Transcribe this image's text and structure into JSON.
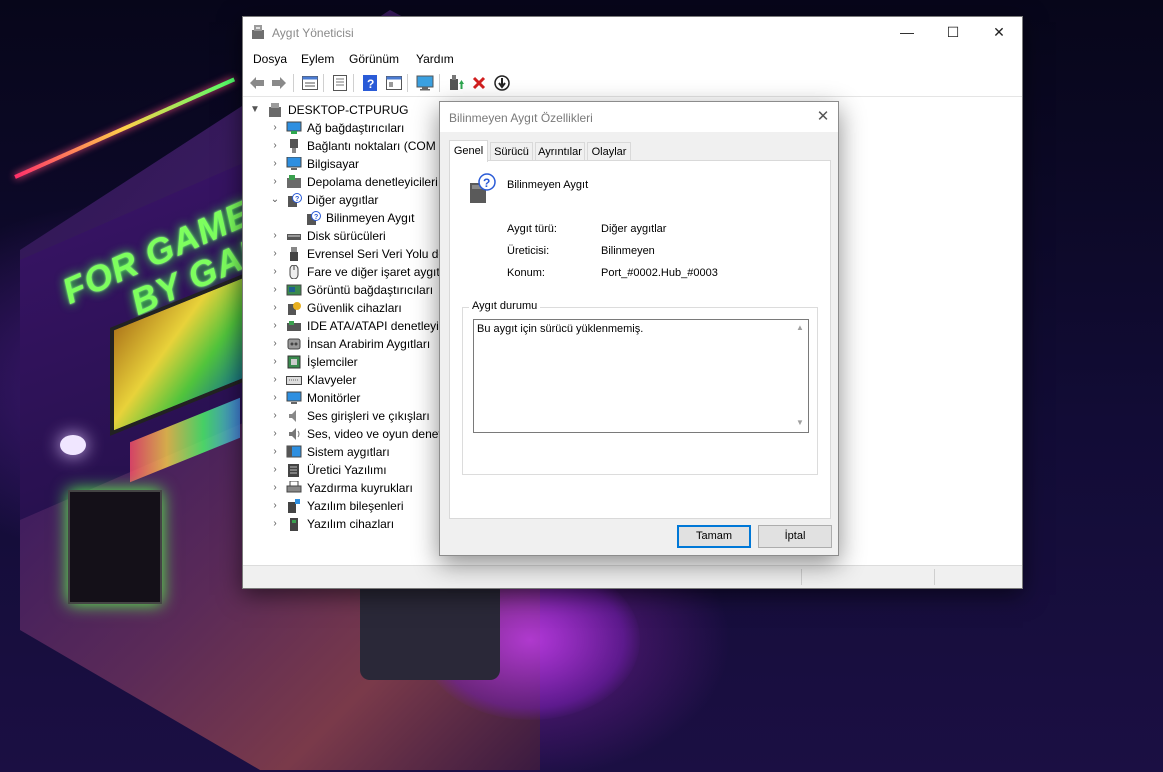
{
  "window": {
    "title": "Aygıt Yöneticisi",
    "controls": {
      "minimize": "—",
      "maximize": "☐",
      "close": "✕"
    }
  },
  "menu": [
    "Dosya",
    "Eylem",
    "Görünüm",
    "Yardım"
  ],
  "toolbar": {
    "icons": [
      "back-arrow-icon",
      "forward-arrow-icon",
      "properties-grid-icon",
      "list-view-icon",
      "help-icon",
      "details-view-icon",
      "scan-monitor-icon",
      "add-driver-icon",
      "uninstall-x-icon",
      "update-driver-icon"
    ],
    "colors": {
      "uninstall": "#d11f1f",
      "help": "#2a5bd7"
    }
  },
  "tree": {
    "root": "DESKTOP-CTPURUG",
    "items": [
      {
        "label": "Ağ bağdaştırıcıları",
        "icon": "network-adapter-icon"
      },
      {
        "label": "Bağlantı noktaları (COM ve LPT)",
        "icon": "port-icon"
      },
      {
        "label": "Bilgisayar",
        "icon": "computer-icon"
      },
      {
        "label": "Depolama denetleyicileri",
        "icon": "storage-controller-icon"
      },
      {
        "label": "Diğer aygıtlar",
        "icon": "other-devices-icon",
        "expanded": true
      },
      {
        "label": "Bilinmeyen Aygıt",
        "icon": "unknown-device-icon",
        "child": true
      },
      {
        "label": "Disk sürücüleri",
        "icon": "disk-drive-icon"
      },
      {
        "label": "Evrensel Seri Veri Yolu denetleyicileri",
        "icon": "usb-icon"
      },
      {
        "label": "Fare ve diğer işaret aygıtları",
        "icon": "mouse-icon"
      },
      {
        "label": "Görüntü bağdaştırıcıları",
        "icon": "display-adapter-icon"
      },
      {
        "label": "Güvenlik cihazları",
        "icon": "security-device-icon"
      },
      {
        "label": "IDE ATA/ATAPI denetleyicileri",
        "icon": "ide-controller-icon"
      },
      {
        "label": "İnsan Arabirim Aygıtları",
        "icon": "hid-icon"
      },
      {
        "label": "İşlemciler",
        "icon": "processor-icon"
      },
      {
        "label": "Klavyeler",
        "icon": "keyboard-icon"
      },
      {
        "label": "Monitörler",
        "icon": "monitor-icon"
      },
      {
        "label": "Ses girişleri ve çıkışları",
        "icon": "audio-io-icon"
      },
      {
        "label": "Ses, video ve oyun denetleyicileri",
        "icon": "sound-video-icon"
      },
      {
        "label": "Sistem aygıtları",
        "icon": "system-devices-icon"
      },
      {
        "label": "Üretici Yazılımı",
        "icon": "firmware-icon"
      },
      {
        "label": "Yazdırma kuyrukları",
        "icon": "print-queue-icon"
      },
      {
        "label": "Yazılım bileşenleri",
        "icon": "software-component-icon"
      },
      {
        "label": "Yazılım cihazları",
        "icon": "software-device-icon"
      }
    ]
  },
  "dialog": {
    "title": "Bilinmeyen Aygıt Özellikleri",
    "tabs": [
      "Genel",
      "Sürücü",
      "Ayrıntılar",
      "Olaylar"
    ],
    "active_tab": "Genel",
    "device_name": "Bilinmeyen Aygıt",
    "props": [
      {
        "key": "Aygıt türü:",
        "value": "Diğer aygıtlar"
      },
      {
        "key": "Üreticisi:",
        "value": "Bilinmeyen"
      },
      {
        "key": "Konum:",
        "value": "Port_#0002.Hub_#0003"
      }
    ],
    "status_group": "Aygıt durumu",
    "status_text": "Bu aygıt için sürücü yüklenmemiş.",
    "buttons": {
      "ok": "Tamam",
      "cancel": "İptal"
    }
  },
  "wallpaper": {
    "neon_text_line1": "FOR GAMERS",
    "neon_text_line2": "BY GAMERS",
    "accent_green": "#7dff5e",
    "accent_pink": "#ff2f6a"
  }
}
